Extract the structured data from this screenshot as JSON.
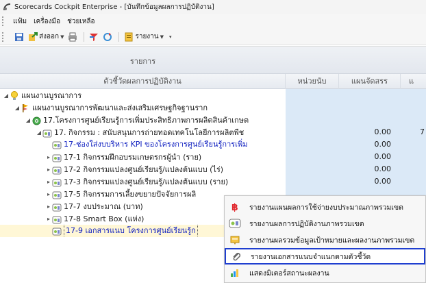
{
  "window": {
    "title": "Scorecards Cockpit Enterprise - [บันทึกข้อมูลผลการปฏิบัติงาน]"
  },
  "menubar": {
    "items": [
      "แฟ้ม",
      "เครื่องมือ",
      "ช่วยเหลือ"
    ]
  },
  "toolbar": {
    "export_label": "ส่งออก",
    "report_label": "รายงาน"
  },
  "grid": {
    "group_header": "รายการ",
    "columns": {
      "indicator": "ตัวชี้วัดผลการปฏิบัติงาน",
      "unit": "หน่วยนับ",
      "plan": "แผนจัดสรร",
      "extra": "แ"
    },
    "rows": [
      {
        "name": "แผนงานบูรณาการ",
        "plan": "",
        "extra": ""
      },
      {
        "name": "แผนงานบูรณาการพัฒนาและส่งเสริมเศรษฐกิจฐานราก",
        "plan": "",
        "extra": ""
      },
      {
        "name": "17.โครงการศูนย์เรียนรู้การเพิ่มประสิทธิภาพการผลิตสินค้าเกษต",
        "plan": "",
        "extra": ""
      },
      {
        "name": "17. กิจกรรม : สนับสนุนการถ่ายทอดเทคโนโลยีการผลิตพืช",
        "plan": "0.00",
        "extra": "7"
      },
      {
        "name": "17-ช่องใส่งบบริหาร KPI ของโครงการศูนย์เรียนรู้การเพิ่ม",
        "plan": "0.00",
        "extra": ""
      },
      {
        "name": "17-1 กิจกรรมฝึกอบรมเกษตรกรผู้นำ (ราย)",
        "plan": "0.00",
        "extra": ""
      },
      {
        "name": "17-2 กิจกรรมแปลงศูนย์เรียนรู้/แปลงต้นแบบ (ไร่)",
        "plan": "0.00",
        "extra": ""
      },
      {
        "name": "17-3 กิจกรรมแปลงศูนย์เรียนรู้/แปลงต้นแบบ (ราย)",
        "plan": "0.00",
        "extra": ""
      },
      {
        "name": "17-5 กิจกรรมการเลี้ยงขยายปัจจัยการผลิ",
        "plan": "",
        "extra": ""
      },
      {
        "name": "17-7 งบประมาณ (บาท)",
        "plan": "",
        "extra": ""
      },
      {
        "name": "17-8 Smart Box (แห่ง)",
        "plan": "",
        "extra": ""
      },
      {
        "name": "17-9 เอกสารแนบ โครงการศูนย์เรียนรู้ก",
        "plan": "",
        "extra": ""
      }
    ]
  },
  "context_menu": {
    "items": [
      {
        "label": "รายงานแผนผลการใช้จ่ายงบประมาณภาพรวมเขต",
        "icon": "baht-icon"
      },
      {
        "label": "รายงานผลการปฏิบัติงานภาพรวมเขต",
        "icon": "report-icon"
      },
      {
        "label": "รายงานผลรวมข้อมูลเป้าหมายและผลงานภาพรวมเขต",
        "icon": "summary-icon"
      },
      {
        "label": "รายงานเอกสารแนบจำแนกตามตัวชี้วัด",
        "icon": "paperclip-icon"
      },
      {
        "label": "แสดงมิเตอร์สถานะผลงาน",
        "icon": "meter-icon"
      }
    ],
    "highlight_color": "#1f3fd0"
  },
  "colors": {
    "data_column_bg": "#dbe9f7",
    "selected_row_bg": "#fff7d6",
    "kpi_text": "#1020c0"
  }
}
